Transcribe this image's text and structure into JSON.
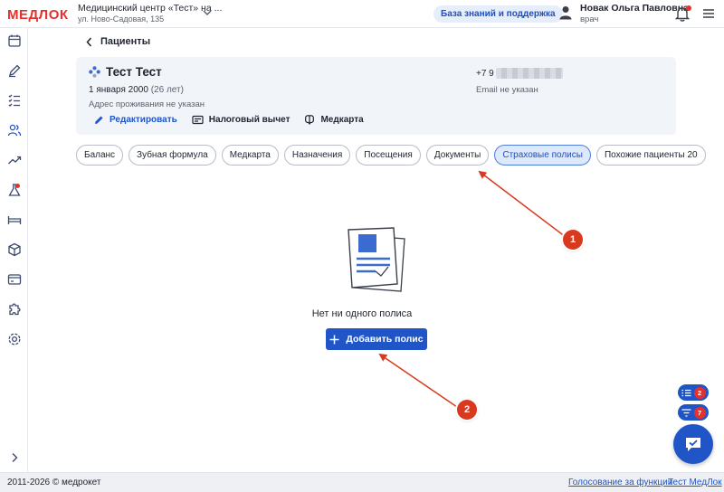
{
  "header": {
    "logo": "МЕДЛОК",
    "clinic_name": "Медицинский центр «Тест» на ...",
    "clinic_address": "ул. Ново-Садовая, 135",
    "knowledge_base_label": "База знаний и поддержка",
    "user_name": "Новак Ольга Павловна",
    "user_role": "врач"
  },
  "sidebar": {
    "icons": [
      "calendar-icon",
      "pen-icon",
      "checklist-icon",
      "users-icon",
      "chart-icon",
      "flask-icon",
      "bed-icon",
      "box-icon",
      "card-icon",
      "puzzle-icon",
      "gear-icon",
      "chevron-right-icon"
    ],
    "lab_has_notification": true
  },
  "page": {
    "back_label": "Пациенты"
  },
  "patient": {
    "name": "Тест Тест",
    "dob": "1 января 2000",
    "age": "(26 лет)",
    "address": "Адрес проживания не указан",
    "phone_prefix": "+7 9",
    "email": "Email не указан",
    "actions": {
      "edit": "Редактировать",
      "tax": "Налоговый вычет",
      "medcard": "Медкарта"
    }
  },
  "tabs": [
    {
      "label": "Баланс",
      "active": false
    },
    {
      "label": "Зубная формула",
      "active": false
    },
    {
      "label": "Медкарта",
      "active": false
    },
    {
      "label": "Назначения",
      "active": false
    },
    {
      "label": "Посещения",
      "active": false
    },
    {
      "label": "Документы",
      "active": false
    },
    {
      "label": "Страховые полисы",
      "active": true
    },
    {
      "label": "Похожие пациенты 20",
      "active": false
    }
  ],
  "empty_state": {
    "message": "Нет ни одного полиса",
    "add_button": "Добавить полис"
  },
  "annotations": {
    "badge_1": "1",
    "badge_2": "2",
    "arrow_color": "#d9391e"
  },
  "floating": {
    "tasks_count": "2",
    "filters_count": "7"
  },
  "footer": {
    "copyright": "2011-2026 © медрокет",
    "vote_link": "Голосование за функции",
    "test_link": "Тест МедЛок"
  },
  "colors": {
    "brand_red": "#e5302e",
    "accent_blue": "#1f55c6",
    "active_tab_bg": "#dde8fb"
  }
}
